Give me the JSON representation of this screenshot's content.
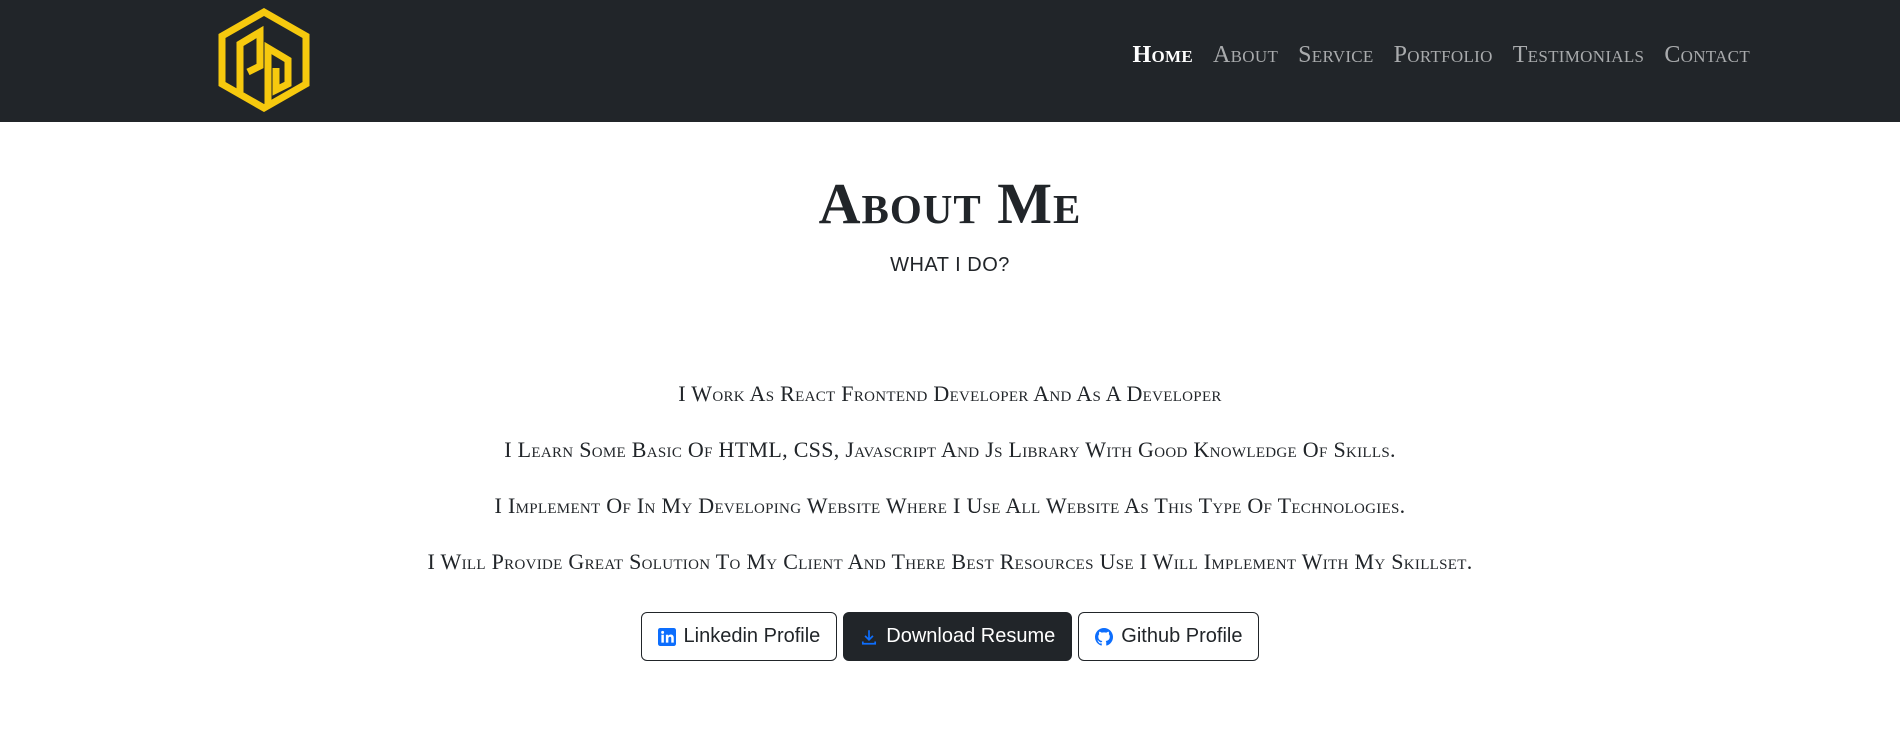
{
  "brand": {
    "logo_icon": "pd-hexagon-logo-icon",
    "logo_color": "#f6c90e"
  },
  "nav": {
    "items": [
      {
        "label": "Home",
        "active": true
      },
      {
        "label": "About",
        "active": false
      },
      {
        "label": "Service",
        "active": false
      },
      {
        "label": "Portfolio",
        "active": false
      },
      {
        "label": "Testimonials",
        "active": false
      },
      {
        "label": "Contact",
        "active": false
      }
    ]
  },
  "about": {
    "title": "About Me",
    "subtitle": "WHAT I DO?",
    "paragraphs": [
      "I Work As React Frontend Developer And As A Developer",
      "I Learn Some Basic Of HTML, CSS, Javascript And Js Library With Good Knowledge Of Skills.",
      "I Implement Of In My Developing Website Where I Use All Website As This Type Of Technologies.",
      "I Will Provide Great Solution To My Client And There Best Resources Use I Will Implement With My Skillset."
    ]
  },
  "buttons": {
    "linkedin": {
      "label": "Linkedin Profile",
      "icon": "linkedin-icon"
    },
    "resume": {
      "label": "Download Resume",
      "icon": "download-icon"
    },
    "github": {
      "label": "Github Profile",
      "icon": "github-icon"
    }
  },
  "colors": {
    "navbar_bg": "#212529",
    "icon_blue": "#0d6efd"
  }
}
